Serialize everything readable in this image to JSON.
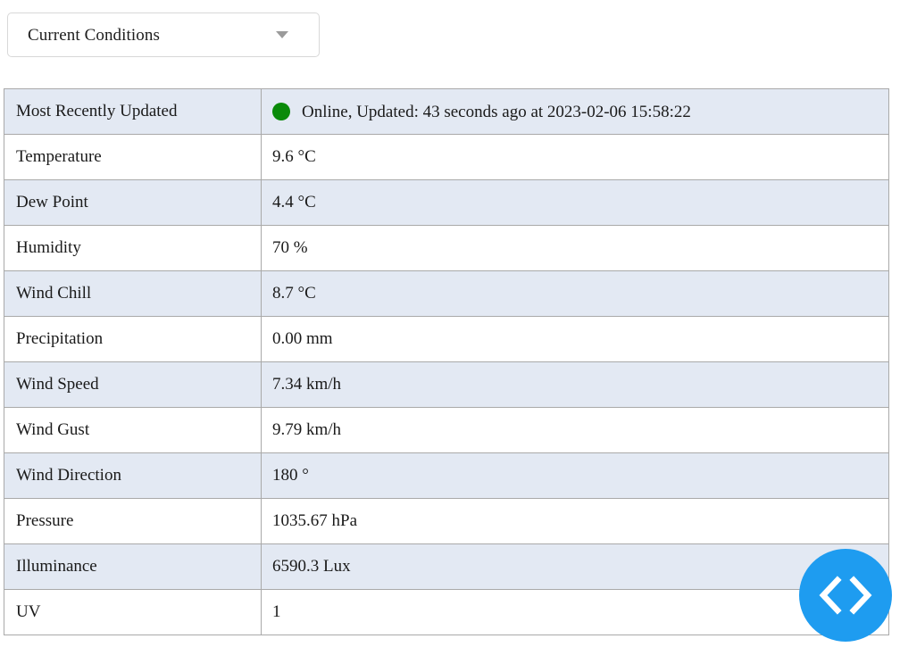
{
  "selector": {
    "name": "view-selector",
    "selected": "Current Conditions",
    "arrow_icon": "chevron-down-icon"
  },
  "table": {
    "status_row": {
      "label": "Most Recently Updated",
      "dot_icon": "online-status-dot",
      "dot_color": "#0a8a0a",
      "status_text": "Online, Updated: 43 seconds ago at 2023-02-06 15:58:22"
    },
    "rows": [
      {
        "label": "Temperature",
        "value": "9.6 °C"
      },
      {
        "label": "Dew Point",
        "value": "4.4 °C"
      },
      {
        "label": "Humidity",
        "value": "70 %"
      },
      {
        "label": "Wind Chill",
        "value": "8.7 °C"
      },
      {
        "label": "Precipitation",
        "value": "0.00 mm"
      },
      {
        "label": "Wind Speed",
        "value": "7.34 km/h"
      },
      {
        "label": "Wind Gust",
        "value": "9.79 km/h"
      },
      {
        "label": "Wind Direction",
        "value": "180 °"
      },
      {
        "label": "Pressure",
        "value": "1035.67 hPa"
      },
      {
        "label": "Illuminance",
        "value": "6590.3 Lux"
      },
      {
        "label": "UV",
        "value": "1"
      }
    ]
  },
  "nav_button": {
    "name": "prev-next-nav-button",
    "prev_icon": "chevron-left-icon",
    "next_icon": "chevron-right-icon",
    "color": "#1e9cf0"
  }
}
